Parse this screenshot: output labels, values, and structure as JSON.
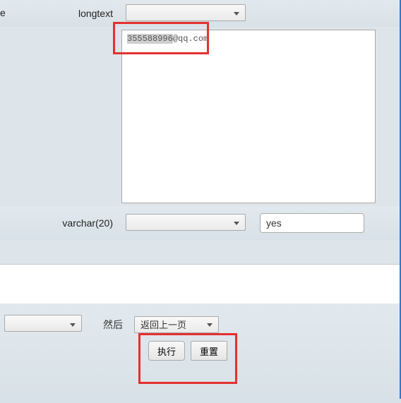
{
  "row1": {
    "label": "longtext",
    "dropdown": "",
    "textarea_selection": "355588996",
    "textarea_rest": "@qq.com"
  },
  "row2": {
    "label": "varchar(20)",
    "dropdown": "",
    "text_value": "yes"
  },
  "footer": {
    "then_label": "然后",
    "back_dropdown": "返回上一页",
    "execute_button": "执行",
    "reset_button": "重置"
  },
  "trunc_left": "e"
}
